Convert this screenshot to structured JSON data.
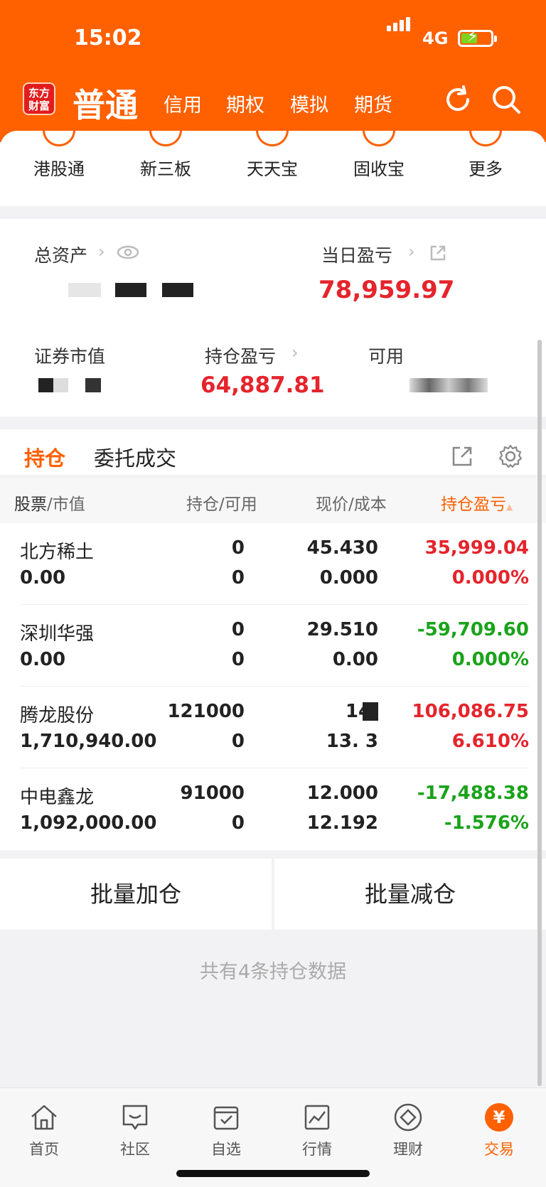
{
  "status_bar": {
    "time": "15:02",
    "network": "4G"
  },
  "header": {
    "logo_text": "东方\n财富",
    "tabs": [
      {
        "label": "普通",
        "active": true
      },
      {
        "label": "信用"
      },
      {
        "label": "期权"
      },
      {
        "label": "模拟"
      },
      {
        "label": "期货"
      }
    ]
  },
  "shortcuts": [
    {
      "label": "港股通",
      "icon": "hk-icon"
    },
    {
      "label": "新三板",
      "icon": "new-icon"
    },
    {
      "label": "天天宝",
      "icon": "piggy-bank-icon"
    },
    {
      "label": "固收宝",
      "icon": "fixed-income-icon"
    },
    {
      "label": "更多",
      "icon": "more-icon"
    }
  ],
  "assets": {
    "total_label": "总资产",
    "daily_pnl_label": "当日盈亏",
    "daily_pnl_value": "78,959.97",
    "market_value_label": "证券市值",
    "position_pnl_label": "持仓盈亏",
    "position_pnl_value": "64,887.81",
    "available_label": "可用"
  },
  "position_tabs": {
    "holdings": "持仓",
    "orders": "委托成交"
  },
  "table_header": {
    "stock": "股票",
    "market_value": "/市值",
    "hold": "持仓",
    "usable": "/可用",
    "price": "现价",
    "cost": "/成本",
    "pnl": "持仓盈亏"
  },
  "rows": [
    {
      "name": "北方稀土",
      "market_value": "0.00",
      "hold": "0",
      "usable": "0",
      "price": "45.430",
      "cost": "0.000",
      "pnl": "35,999.04",
      "pnl_pct": "0.000%",
      "trend": "up"
    },
    {
      "name": "深圳华强",
      "market_value": "0.00",
      "hold": "0",
      "usable": "0",
      "price": "29.510",
      "cost": "0.00",
      "pnl": "-59,709.60",
      "pnl_pct": "0.000%",
      "trend": "down"
    },
    {
      "name": "腾龙股份",
      "market_value": "1,710,940.00",
      "hold": "121000",
      "usable": "0",
      "price": "14.",
      "cost": "13.  3",
      "pnl": "106,086.75",
      "pnl_pct": "6.610%",
      "trend": "up"
    },
    {
      "name": "中电鑫龙",
      "market_value": "1,092,000.00",
      "hold": "91000",
      "usable": "0",
      "price": "12.000",
      "cost": "12.192",
      "pnl": "-17,488.38",
      "pnl_pct": "-1.576%",
      "trend": "down"
    }
  ],
  "actions": {
    "add": "批量加仓",
    "reduce": "批量减仓"
  },
  "footer_note": "共有4条持仓数据",
  "bottom_nav": [
    {
      "label": "首页",
      "icon": "home-icon"
    },
    {
      "label": "社区",
      "icon": "community-icon"
    },
    {
      "label": "自选",
      "icon": "watchlist-icon"
    },
    {
      "label": "行情",
      "icon": "market-chart-icon"
    },
    {
      "label": "理财",
      "icon": "wealth-icon"
    },
    {
      "label": "交易",
      "icon": "trade-icon",
      "active": true
    }
  ],
  "colors": {
    "brand": "#ff6000",
    "up": "#e5242c",
    "down": "#1aa31a"
  }
}
